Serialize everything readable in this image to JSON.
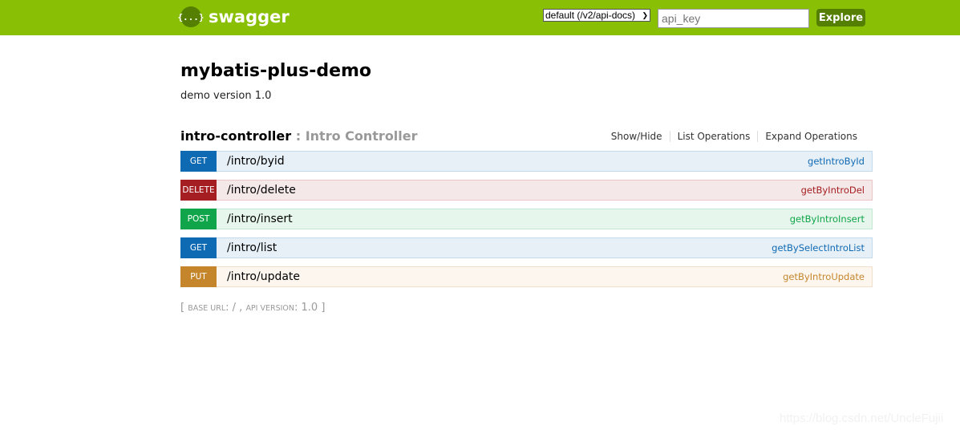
{
  "header": {
    "logo_glyph": "{...}",
    "logo_text": "swagger",
    "spec_select_value": "default (/v2/api-docs)",
    "api_key_placeholder": "api_key",
    "explore_label": "Explore",
    "colors": {
      "bar": "#89bf04",
      "accent": "#547f00"
    }
  },
  "info": {
    "title": "mybatis-plus-demo",
    "version_line": "demo version 1.0"
  },
  "controller": {
    "name": "intro-controller",
    "separator": " : ",
    "description": "Intro Controller",
    "links": [
      "Show/Hide",
      "List Operations",
      "Expand Operations"
    ]
  },
  "operations": [
    {
      "method": "GET",
      "path": "/intro/byid",
      "nickname": "getIntroById",
      "colors": {
        "badge": "#0f6ab4",
        "bg": "#e7f0f7",
        "border": "#c3d9ec",
        "text": "#0f6ab4"
      }
    },
    {
      "method": "DELETE",
      "path": "/intro/delete",
      "nickname": "getByIntroDel",
      "colors": {
        "badge": "#a41e22",
        "bg": "#f5e8e8",
        "border": "#e8c6c7",
        "text": "#a41e22"
      }
    },
    {
      "method": "POST",
      "path": "/intro/insert",
      "nickname": "getByIntroInsert",
      "colors": {
        "badge": "#10a54a",
        "bg": "#e7f6ec",
        "border": "#c3e8d1",
        "text": "#10a54a"
      }
    },
    {
      "method": "GET",
      "path": "/intro/list",
      "nickname": "getBySelectIntroList",
      "colors": {
        "badge": "#0f6ab4",
        "bg": "#e7f0f7",
        "border": "#c3d9ec",
        "text": "#0f6ab4"
      }
    },
    {
      "method": "PUT",
      "path": "/intro/update",
      "nickname": "getByIntroUpdate",
      "colors": {
        "badge": "#c5862b",
        "bg": "#fcf6ef",
        "border": "#f0e0ca",
        "text": "#c5862b"
      }
    }
  ],
  "footer": {
    "open": "[ ",
    "base_url_label": "base url",
    "base_url_value": ": / , ",
    "api_version_label": "api version",
    "api_version_value": ": 1.0 ]"
  },
  "watermark": "https://blog.csdn.net/UncleFujii"
}
